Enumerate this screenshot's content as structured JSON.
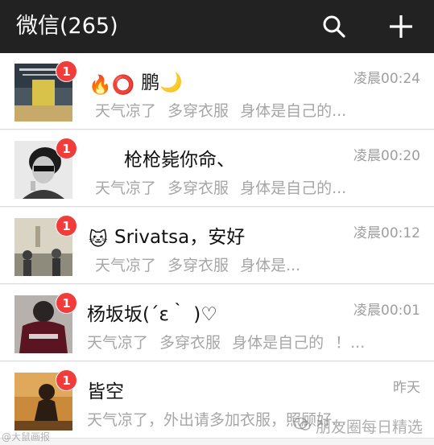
{
  "header": {
    "title": "微信(265)",
    "search_icon": "search-icon",
    "add_icon": "plus-icon"
  },
  "chats": [
    {
      "emoji": "🔥⭕",
      "name": "鹏🌙",
      "time": "凌晨00:24",
      "preview": "天气凉了 多穿衣服 身体是自己的...",
      "unread": "1"
    },
    {
      "emoji": "",
      "name": "枪枪毙你命、",
      "time": "凌晨00:20",
      "preview": "天气凉了 多穿衣服 身体是自己的...",
      "unread": "1"
    },
    {
      "emoji": "🐱",
      "name": "Srivatsa，安好",
      "time": "凌晨00:12",
      "preview": "天气凉了 多穿衣服 身体是...",
      "unread": "1"
    },
    {
      "emoji": "",
      "name": "杨坂坂(´ε｀ )♡",
      "time": "凌晨00:01",
      "preview": "天气凉了 多穿衣服 身体是自己的 ！...",
      "unread": "1"
    },
    {
      "emoji": "",
      "name": "皆空",
      "time": "昨天",
      "preview": "天气凉了，外出请多加衣服，照顾好...",
      "unread": "1"
    }
  ],
  "watermarks": {
    "left": "@大鼠画报",
    "right": "朋友圈每日精选"
  },
  "colors": {
    "header_bg": "#222222",
    "badge": "#f23c3c",
    "time_text": "#9e9e9e",
    "preview_text": "#a6a6a6"
  }
}
